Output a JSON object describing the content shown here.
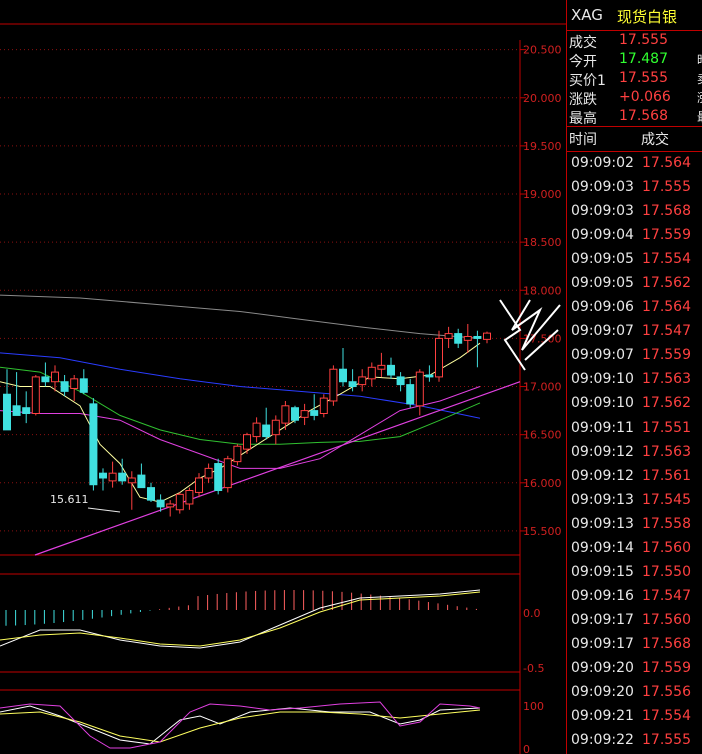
{
  "instrument": {
    "symbol": "XAG",
    "name": "现货白银"
  },
  "quotes": [
    {
      "label": "成交",
      "value": "17.555",
      "color": "red",
      "side_label": ""
    },
    {
      "label": "今开",
      "value": "17.487",
      "color": "green",
      "side_label": "昨"
    },
    {
      "label": "买价1",
      "value": "17.555",
      "color": "red",
      "side_label": "卖"
    },
    {
      "label": "涨跌",
      "value": "+0.066",
      "color": "red",
      "side_label": "涨"
    },
    {
      "label": "最高",
      "value": "17.568",
      "color": "red",
      "side_label": "最"
    }
  ],
  "ticks_header": {
    "time": "时间",
    "price": "成交"
  },
  "ticks": [
    {
      "time": "09:09:02",
      "price": "17.564"
    },
    {
      "time": "09:09:03",
      "price": "17.555"
    },
    {
      "time": "09:09:03",
      "price": "17.568"
    },
    {
      "time": "09:09:04",
      "price": "17.559"
    },
    {
      "time": "09:09:05",
      "price": "17.554"
    },
    {
      "time": "09:09:05",
      "price": "17.562"
    },
    {
      "time": "09:09:06",
      "price": "17.564"
    },
    {
      "time": "09:09:07",
      "price": "17.547"
    },
    {
      "time": "09:09:07",
      "price": "17.559"
    },
    {
      "time": "09:09:10",
      "price": "17.563"
    },
    {
      "time": "09:09:10",
      "price": "17.562"
    },
    {
      "time": "09:09:11",
      "price": "17.551"
    },
    {
      "time": "09:09:12",
      "price": "17.563"
    },
    {
      "time": "09:09:12",
      "price": "17.561"
    },
    {
      "time": "09:09:13",
      "price": "17.545"
    },
    {
      "time": "09:09:13",
      "price": "17.558"
    },
    {
      "time": "09:09:14",
      "price": "17.560"
    },
    {
      "time": "09:09:15",
      "price": "17.550"
    },
    {
      "time": "09:09:16",
      "price": "17.547"
    },
    {
      "time": "09:09:17",
      "price": "17.560"
    },
    {
      "time": "09:09:17",
      "price": "17.568"
    },
    {
      "time": "09:09:20",
      "price": "17.559"
    },
    {
      "time": "09:09:20",
      "price": "17.556"
    },
    {
      "time": "09:09:21",
      "price": "17.554"
    },
    {
      "time": "09:09:22",
      "price": "17.555"
    }
  ],
  "chart_data": {
    "type": "candlestick",
    "price_axis": {
      "ticks": [
        "20.500",
        "20.000",
        "19.500",
        "19.000",
        "18.500",
        "18.000",
        "17.500",
        "17.000",
        "16.500",
        "16.000",
        "15.500"
      ],
      "range": [
        15.25,
        20.6
      ]
    },
    "low_annotation": "15.611",
    "candles": [
      {
        "o": 16.92,
        "h": 17.18,
        "l": 16.55,
        "c": 16.55
      },
      {
        "o": 16.8,
        "h": 17.15,
        "l": 16.7,
        "c": 16.7
      },
      {
        "o": 16.78,
        "h": 16.95,
        "l": 16.62,
        "c": 16.72
      },
      {
        "o": 16.72,
        "h": 17.12,
        "l": 16.7,
        "c": 17.1
      },
      {
        "o": 17.1,
        "h": 17.25,
        "l": 17.0,
        "c": 17.05
      },
      {
        "o": 17.05,
        "h": 17.22,
        "l": 16.95,
        "c": 17.15
      },
      {
        "o": 17.05,
        "h": 17.12,
        "l": 16.9,
        "c": 16.95
      },
      {
        "o": 16.98,
        "h": 17.12,
        "l": 16.85,
        "c": 17.08
      },
      {
        "o": 17.08,
        "h": 17.18,
        "l": 16.92,
        "c": 16.94
      },
      {
        "o": 16.82,
        "h": 16.88,
        "l": 15.92,
        "c": 15.98
      },
      {
        "o": 16.1,
        "h": 16.15,
        "l": 15.92,
        "c": 16.05
      },
      {
        "o": 16.02,
        "h": 16.22,
        "l": 15.95,
        "c": 16.1
      },
      {
        "o": 16.1,
        "h": 16.25,
        "l": 15.98,
        "c": 16.02
      },
      {
        "o": 16.0,
        "h": 16.12,
        "l": 15.72,
        "c": 16.05
      },
      {
        "o": 16.08,
        "h": 16.2,
        "l": 16.0,
        "c": 15.95
      },
      {
        "o": 15.95,
        "h": 16.0,
        "l": 15.8,
        "c": 15.82
      },
      {
        "o": 15.82,
        "h": 15.88,
        "l": 15.7,
        "c": 15.75
      },
      {
        "o": 15.75,
        "h": 15.82,
        "l": 15.65,
        "c": 15.78
      },
      {
        "o": 15.72,
        "h": 15.9,
        "l": 15.68,
        "c": 15.88
      },
      {
        "o": 15.78,
        "h": 15.95,
        "l": 15.72,
        "c": 15.92
      },
      {
        "o": 15.9,
        "h": 16.1,
        "l": 15.85,
        "c": 16.05
      },
      {
        "o": 16.05,
        "h": 16.2,
        "l": 16.0,
        "c": 16.15
      },
      {
        "o": 16.2,
        "h": 16.25,
        "l": 15.88,
        "c": 15.92
      },
      {
        "o": 15.95,
        "h": 16.28,
        "l": 15.9,
        "c": 16.25
      },
      {
        "o": 16.22,
        "h": 16.4,
        "l": 16.18,
        "c": 16.38
      },
      {
        "o": 16.35,
        "h": 16.52,
        "l": 16.3,
        "c": 16.5
      },
      {
        "o": 16.48,
        "h": 16.68,
        "l": 16.42,
        "c": 16.62
      },
      {
        "o": 16.6,
        "h": 16.78,
        "l": 16.45,
        "c": 16.48
      },
      {
        "o": 16.5,
        "h": 16.7,
        "l": 16.4,
        "c": 16.65
      },
      {
        "o": 16.62,
        "h": 16.85,
        "l": 16.55,
        "c": 16.8
      },
      {
        "o": 16.78,
        "h": 16.8,
        "l": 16.62,
        "c": 16.65
      },
      {
        "o": 16.68,
        "h": 16.82,
        "l": 16.6,
        "c": 16.75
      },
      {
        "o": 16.75,
        "h": 16.92,
        "l": 16.65,
        "c": 16.7
      },
      {
        "o": 16.72,
        "h": 16.92,
        "l": 16.68,
        "c": 16.88
      },
      {
        "o": 16.85,
        "h": 17.22,
        "l": 16.8,
        "c": 17.18
      },
      {
        "o": 17.18,
        "h": 17.4,
        "l": 17.0,
        "c": 17.05
      },
      {
        "o": 17.05,
        "h": 17.18,
        "l": 16.95,
        "c": 17.0
      },
      {
        "o": 17.02,
        "h": 17.18,
        "l": 16.95,
        "c": 17.1
      },
      {
        "o": 17.08,
        "h": 17.25,
        "l": 17.0,
        "c": 17.2
      },
      {
        "o": 17.18,
        "h": 17.35,
        "l": 17.1,
        "c": 17.22
      },
      {
        "o": 17.22,
        "h": 17.3,
        "l": 17.08,
        "c": 17.12
      },
      {
        "o": 17.1,
        "h": 17.15,
        "l": 16.95,
        "c": 17.02
      },
      {
        "o": 17.02,
        "h": 17.08,
        "l": 16.78,
        "c": 16.82
      },
      {
        "o": 16.8,
        "h": 17.18,
        "l": 16.7,
        "c": 17.15
      },
      {
        "o": 17.12,
        "h": 17.22,
        "l": 17.05,
        "c": 17.1
      },
      {
        "o": 17.1,
        "h": 17.58,
        "l": 17.05,
        "c": 17.5
      },
      {
        "o": 17.5,
        "h": 17.62,
        "l": 17.4,
        "c": 17.55
      },
      {
        "o": 17.55,
        "h": 17.6,
        "l": 17.4,
        "c": 17.45
      },
      {
        "o": 17.48,
        "h": 17.65,
        "l": 17.35,
        "c": 17.52
      },
      {
        "o": 17.52,
        "h": 17.58,
        "l": 17.2,
        "c": 17.5
      },
      {
        "o": 17.49,
        "h": 17.57,
        "l": 17.45,
        "c": 17.555
      }
    ],
    "ma_lines": [
      {
        "color": "#8a8a8a",
        "points": [
          [
            0,
            17.95
          ],
          [
            80,
            17.92
          ],
          [
            160,
            17.85
          ],
          [
            240,
            17.78
          ],
          [
            300,
            17.7
          ],
          [
            360,
            17.62
          ],
          [
            420,
            17.55
          ],
          [
            480,
            17.5
          ]
        ]
      },
      {
        "color": "#2a3cff",
        "points": [
          [
            0,
            17.35
          ],
          [
            60,
            17.3
          ],
          [
            120,
            17.18
          ],
          [
            180,
            17.08
          ],
          [
            240,
            17.0
          ],
          [
            300,
            16.95
          ],
          [
            360,
            16.9
          ],
          [
            420,
            16.8
          ],
          [
            480,
            16.67
          ]
        ]
      },
      {
        "color": "#30c030",
        "points": [
          [
            0,
            17.2
          ],
          [
            40,
            17.15
          ],
          [
            80,
            16.95
          ],
          [
            120,
            16.7
          ],
          [
            160,
            16.55
          ],
          [
            200,
            16.45
          ],
          [
            240,
            16.4
          ],
          [
            280,
            16.4
          ],
          [
            320,
            16.42
          ],
          [
            360,
            16.43
          ],
          [
            400,
            16.48
          ],
          [
            440,
            16.65
          ],
          [
            480,
            16.83
          ]
        ]
      },
      {
        "color": "#e040e0",
        "points": [
          [
            0,
            16.75
          ],
          [
            40,
            16.72
          ],
          [
            80,
            16.72
          ],
          [
            120,
            16.65
          ],
          [
            160,
            16.45
          ],
          [
            200,
            16.3
          ],
          [
            240,
            16.15
          ],
          [
            280,
            16.15
          ],
          [
            320,
            16.25
          ],
          [
            360,
            16.5
          ],
          [
            400,
            16.75
          ],
          [
            440,
            16.85
          ],
          [
            480,
            17.0
          ]
        ]
      },
      {
        "color": "#ffffa0",
        "points": [
          [
            0,
            17.05
          ],
          [
            20,
            17.0
          ],
          [
            50,
            17.0
          ],
          [
            80,
            16.8
          ],
          [
            100,
            16.4
          ],
          [
            120,
            16.2
          ],
          [
            140,
            15.85
          ],
          [
            160,
            15.8
          ],
          [
            180,
            15.9
          ],
          [
            200,
            16.05
          ],
          [
            220,
            16.15
          ],
          [
            250,
            16.35
          ],
          [
            280,
            16.55
          ],
          [
            310,
            16.75
          ],
          [
            340,
            16.92
          ],
          [
            370,
            17.1
          ],
          [
            400,
            17.08
          ],
          [
            430,
            17.12
          ],
          [
            460,
            17.3
          ],
          [
            480,
            17.45
          ]
        ]
      }
    ],
    "trendline": {
      "from": [
        35,
        15.25
      ],
      "to": [
        520,
        17.05
      ]
    },
    "macd": {
      "axis_ticks": [
        "0.0",
        "-0.5"
      ]
    },
    "kdj": {
      "axis_ticks": [
        "100",
        "0"
      ]
    }
  }
}
